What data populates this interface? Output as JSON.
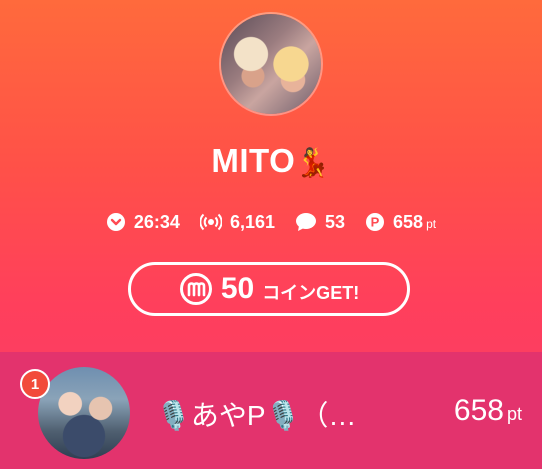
{
  "profile": {
    "name": "MITO",
    "name_emoji": "💃"
  },
  "stats": {
    "time": "26:34",
    "viewers": "6,161",
    "comments": "53",
    "points": "658",
    "points_unit": "pt"
  },
  "coin_button": {
    "amount": "50",
    "label": "コインGET!"
  },
  "ranking": {
    "rank": "1",
    "name": "🎙️あやP🎙️（…",
    "points": "658",
    "points_unit": "pt"
  },
  "colors": {
    "bg_top": "#ff6a3c",
    "bg_bottom": "#f73b6a",
    "rank_row": "#e3336d",
    "badge": "#f24b3a"
  }
}
